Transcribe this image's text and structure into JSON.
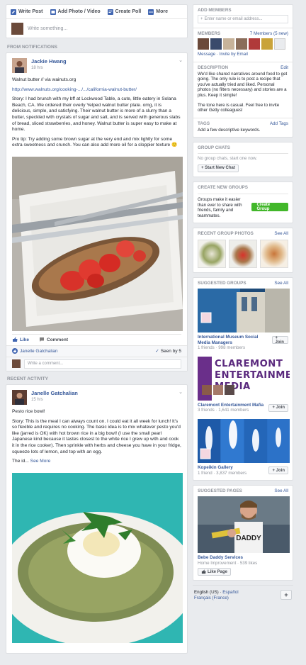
{
  "composer": {
    "tabs": [
      {
        "label": "Write Post",
        "icon": "pencil-icon",
        "color": "#4267b2"
      },
      {
        "label": "Add Photo / Video",
        "icon": "photo-icon",
        "color": "#4267b2"
      },
      {
        "label": "Create Poll",
        "icon": "poll-icon",
        "color": "#4267b2"
      },
      {
        "label": "More",
        "icon": "more-icon",
        "color": "#4267b2"
      }
    ],
    "placeholder": "Write something..."
  },
  "sections": {
    "notifications": "FROM NOTIFICATIONS",
    "recent": "RECENT ACTIVITY"
  },
  "post1": {
    "author": "Jackie Hwang",
    "time": "18 hrs",
    "lines": [
      "Walnut butter // via wainuts.org",
      "http://www.walnuts.org/cooking-.../.../california-walnut-butter/",
      "Story: I had brunch with my bff at Lockwood Table, a cute, little eatery in Solana Beach, CA. We ordered their overly Yelped walnut butter plate. omg, it is delicious, simple, and satisfying. Their walnut butter is more of a slurry than a butter, speckled with crystals of sugar and salt, and is served with generous slabs of bread, sliced strawberries, and honey. Walnut butter is super easy to make at home.",
      "Pro tip: Try adding some brown sugar at the very end and mix lightly for some extra sweetness and crunch. You can also add more oil for a sloppier texture 🙂"
    ],
    "like": "Like",
    "comment": "Comment",
    "seen_name": "Janelle Gatchalian",
    "seen": "Seen by 5",
    "comment_placeholder": "Write a comment..."
  },
  "post2": {
    "author": "Janelle Gatchalian",
    "time": "15 hrs",
    "title": "Pesto rice bowl!",
    "story": "Story: This is the meal I can always count on. I could eat it all week for lunch! It's so flexible and requires no cooking. The basic idea is to mix whatever pesto you'd like (jarred is OK) with hot brown rice in a big bowl! (I use the small pearl Japanese kind because it tastes closest to the white rice I grew up with and cook it in the rice cooker). Then sprinkle with herbs and cheese you have in your fridge, squeeze lots of lemon, and top with an egg.",
    "more_prefix": "The id...",
    "see_more": "See More"
  },
  "right": {
    "add_members": {
      "title": "ADD MEMBERS",
      "placeholder": "Enter name or email address..."
    },
    "members": {
      "title": "MEMBERS",
      "count": "7 Members (5 new)",
      "message": "Message",
      "invite": "Invite by Email"
    },
    "description": {
      "title": "DESCRIPTION",
      "edit": "Edit",
      "text1": "We'd like shared narratives around food to get going. The only rule is to post a recipe that you've actually tried and liked. Personal photos (no filters necessary) and stories are a plus. Keep it simple!",
      "text2": "The tone here is casual. Feel free to invite other Getty colleagues!"
    },
    "tags": {
      "title": "TAGS",
      "add": "Add Tags",
      "text": "Add a few descriptive keywords."
    },
    "group_chats": {
      "title": "GROUP CHATS",
      "text": "No group chats, start one now.",
      "button": "+ Start New Chat"
    },
    "create_groups": {
      "title": "CREATE NEW GROUPS",
      "text": "Groups make it easier than ever to share with friends, family and teammates.",
      "button": "Create Group"
    },
    "recent_photos": {
      "title": "RECENT GROUP PHOTOS",
      "see_all": "See All"
    },
    "suggested_groups": {
      "title": "SUGGESTED GROUPS",
      "see_all": "See All",
      "groups": [
        {
          "name": "International Museum Social Media Managers",
          "meta": "1 friends · 998 members",
          "join": "+ Join"
        },
        {
          "name": "Claremont Entertainment Mafia",
          "meta": "3 friends · 1,641 members",
          "join": "+ Join",
          "banner": "CLAREMONT ENTERTAINMENT MEDIA"
        },
        {
          "name": "Kopeikin Gallery",
          "meta": "1 friend · 3,837 members",
          "join": "+ Join"
        }
      ]
    },
    "suggested_pages": {
      "title": "SUGGESTED PAGES",
      "see_all": "See All",
      "name": "Bebe Daddy Services",
      "meta": "Home Improvement · 539 likes",
      "button": "Like Page",
      "shirt": "DADDY"
    },
    "footer": {
      "lang1": "English (US)",
      "lang2": "Español",
      "lang3": "Français (France)",
      "plus": "+"
    }
  }
}
